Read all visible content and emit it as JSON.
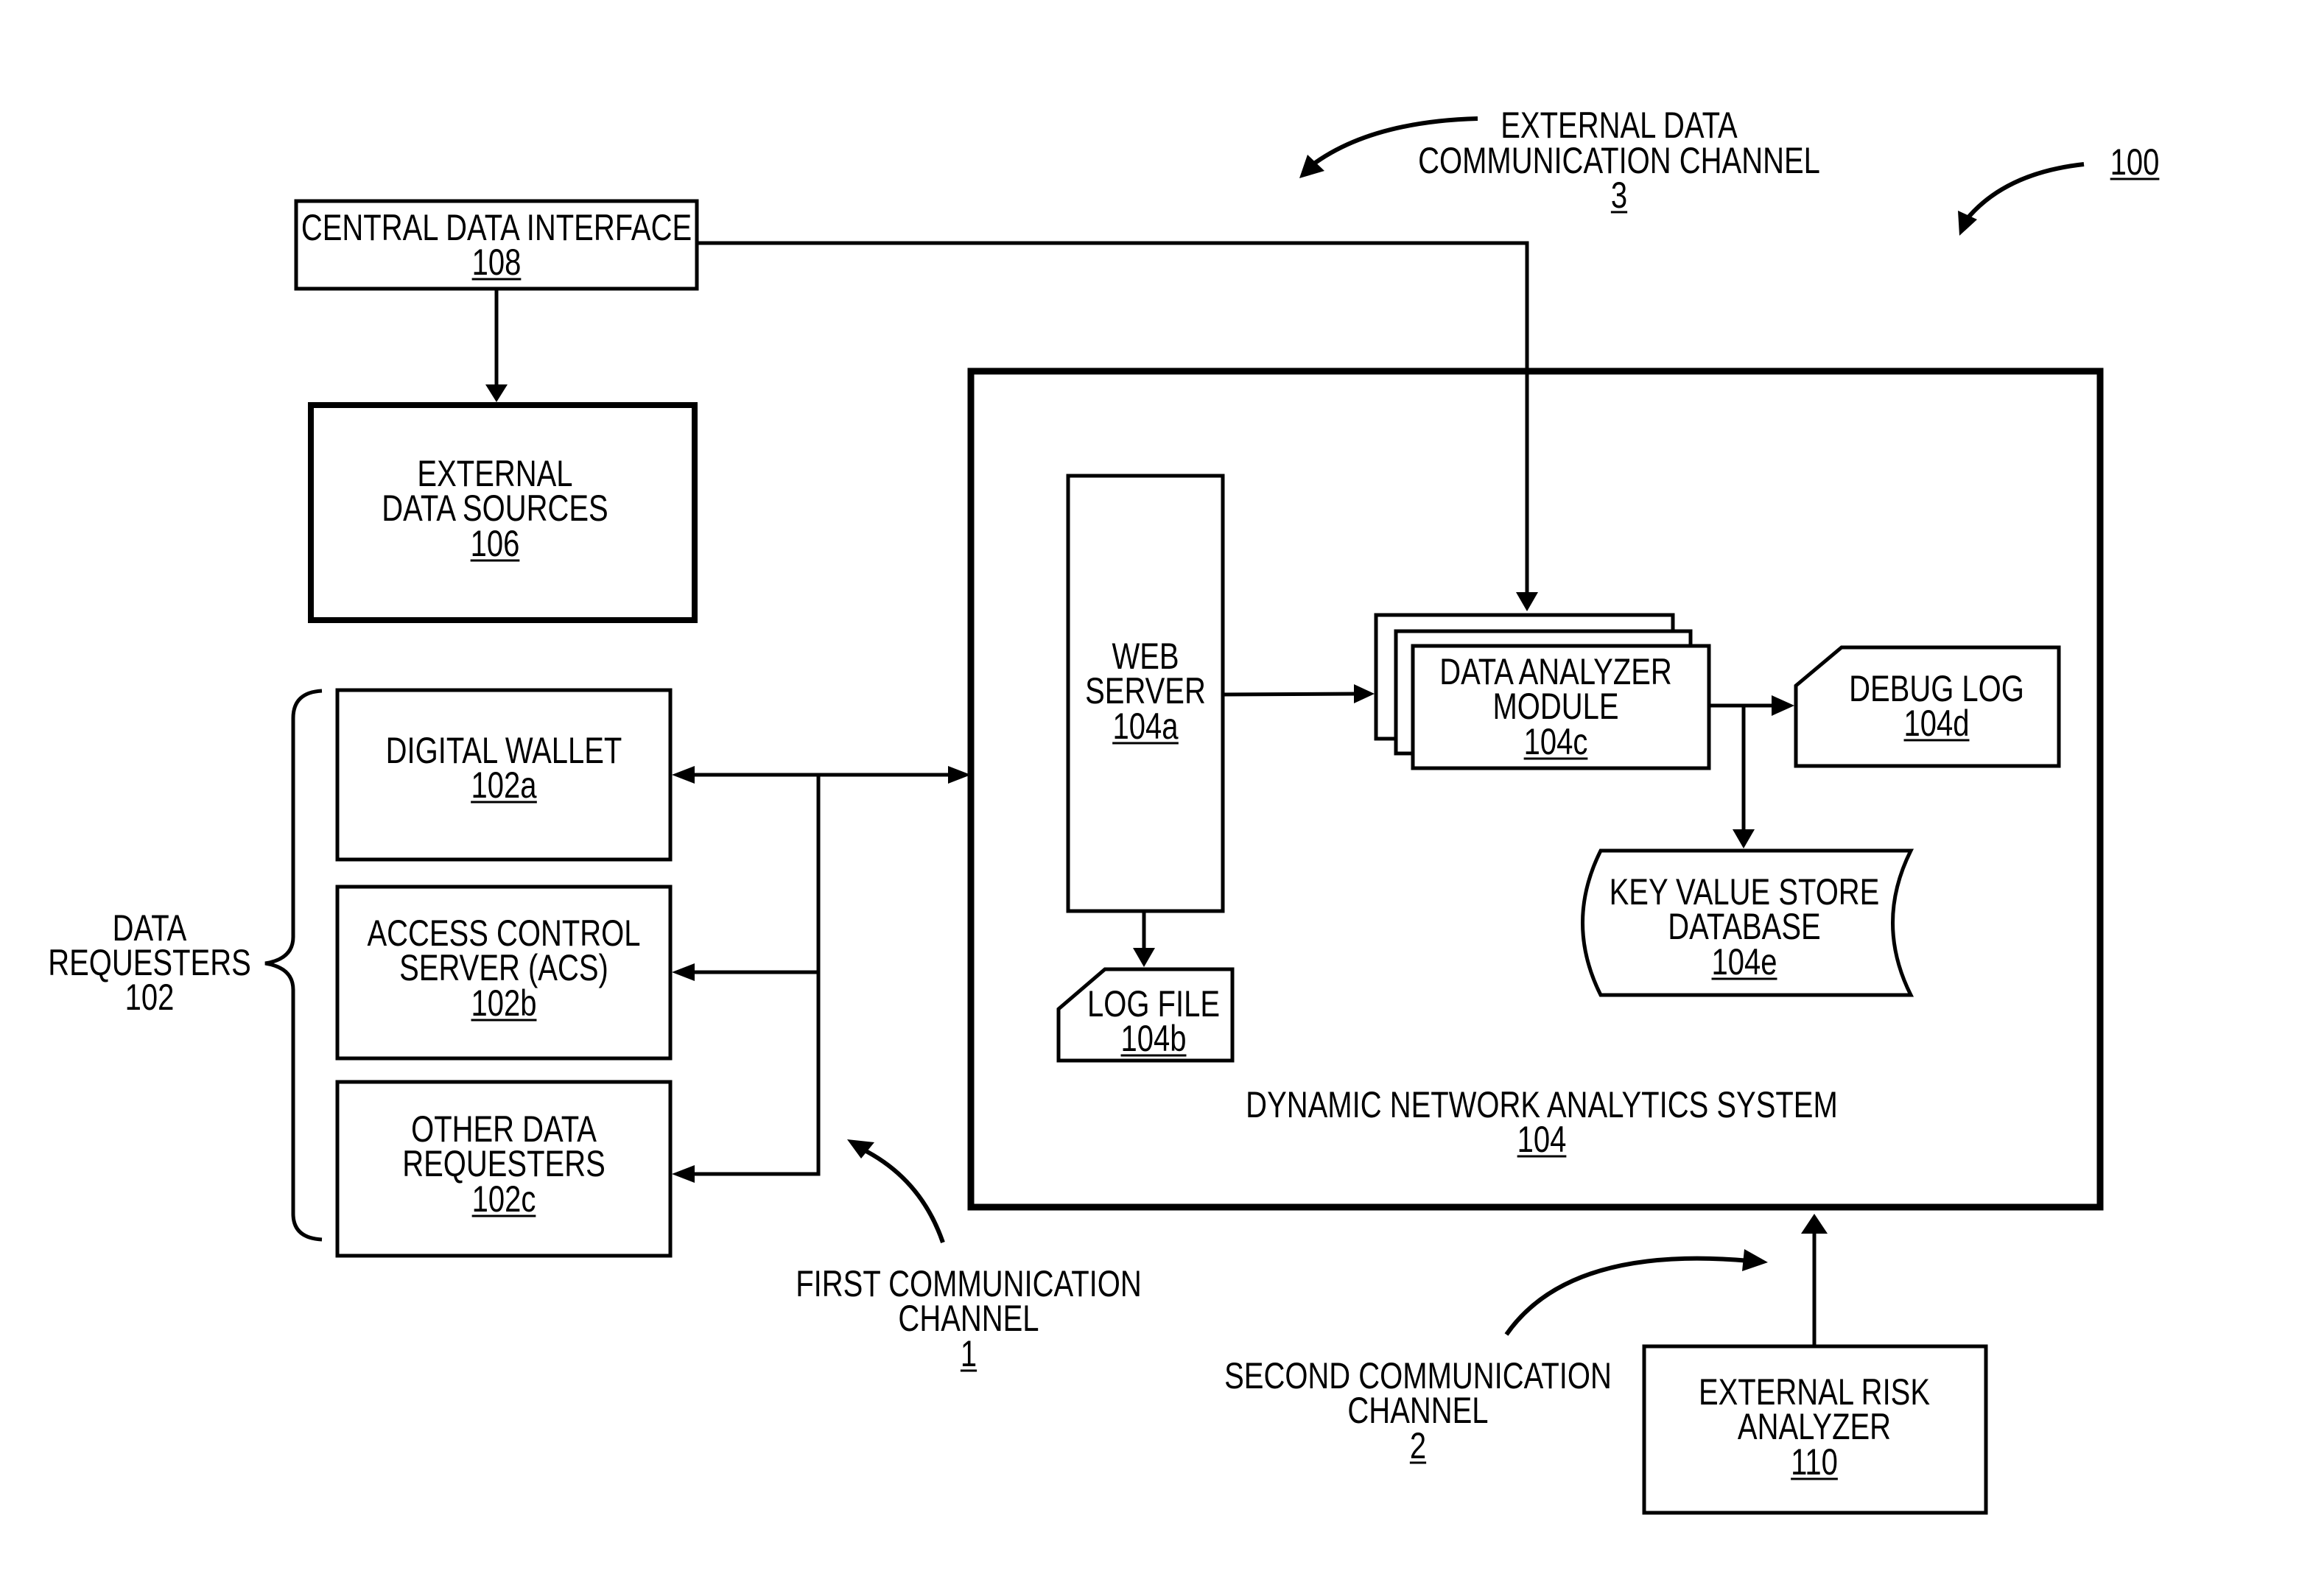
{
  "figure": {
    "reference": "100",
    "colors": {
      "ink": "#000000",
      "background": "#ffffff"
    }
  },
  "nodes": {
    "central_data_interface": {
      "lines": [
        "CENTRAL DATA INTERFACE"
      ],
      "ref": "108"
    },
    "external_data_sources": {
      "lines": [
        "EXTERNAL",
        "DATA SOURCES"
      ],
      "ref": "106"
    },
    "digital_wallet": {
      "lines": [
        "DIGITAL WALLET"
      ],
      "ref": "102a"
    },
    "access_control_server": {
      "lines": [
        "ACCESS CONTROL",
        "SERVER (ACS)"
      ],
      "ref": "102b"
    },
    "other_data_requesters": {
      "lines": [
        "OTHER DATA",
        "REQUESTERS"
      ],
      "ref": "102c"
    },
    "data_requesters_group": {
      "lines": [
        "DATA",
        "REQUESTERS"
      ],
      "ref": "102"
    },
    "dynamic_network_analytics_system": {
      "lines": [
        "DYNAMIC NETWORK ANALYTICS SYSTEM"
      ],
      "ref": "104"
    },
    "web_server": {
      "lines": [
        "WEB",
        "SERVER"
      ],
      "ref": "104a"
    },
    "log_file": {
      "lines": [
        "LOG FILE"
      ],
      "ref": "104b"
    },
    "data_analyzer_module": {
      "lines": [
        "DATA ANALYZER",
        "MODULE"
      ],
      "ref": "104c"
    },
    "debug_log": {
      "lines": [
        "DEBUG LOG"
      ],
      "ref": "104d"
    },
    "key_value_store_database": {
      "lines": [
        "KEY VALUE STORE",
        "DATABASE"
      ],
      "ref": "104e"
    },
    "external_risk_analyzer": {
      "lines": [
        "EXTERNAL RISK",
        "ANALYZER"
      ],
      "ref": "110"
    }
  },
  "channels": {
    "first": {
      "lines": [
        "FIRST COMMUNICATION",
        "CHANNEL"
      ],
      "ref": "1"
    },
    "second": {
      "lines": [
        "SECOND COMMUNICATION",
        "CHANNEL"
      ],
      "ref": "2"
    },
    "external": {
      "lines": [
        "EXTERNAL DATA",
        "COMMUNICATION CHANNEL"
      ],
      "ref": "3"
    }
  },
  "edges": [
    {
      "from": "central_data_interface",
      "to": "external_data_sources"
    },
    {
      "from": "central_data_interface",
      "to": "data_analyzer_module"
    },
    {
      "from": "data_requesters",
      "to": "dynamic_network_analytics_system",
      "bidirectional": true
    },
    {
      "from": "web_server",
      "to": "data_analyzer_module"
    },
    {
      "from": "web_server",
      "to": "log_file"
    },
    {
      "from": "data_analyzer_module",
      "to": "debug_log"
    },
    {
      "from": "data_analyzer_module",
      "to": "key_value_store_database"
    },
    {
      "from": "external_risk_analyzer",
      "to": "dynamic_network_analytics_system"
    }
  ]
}
